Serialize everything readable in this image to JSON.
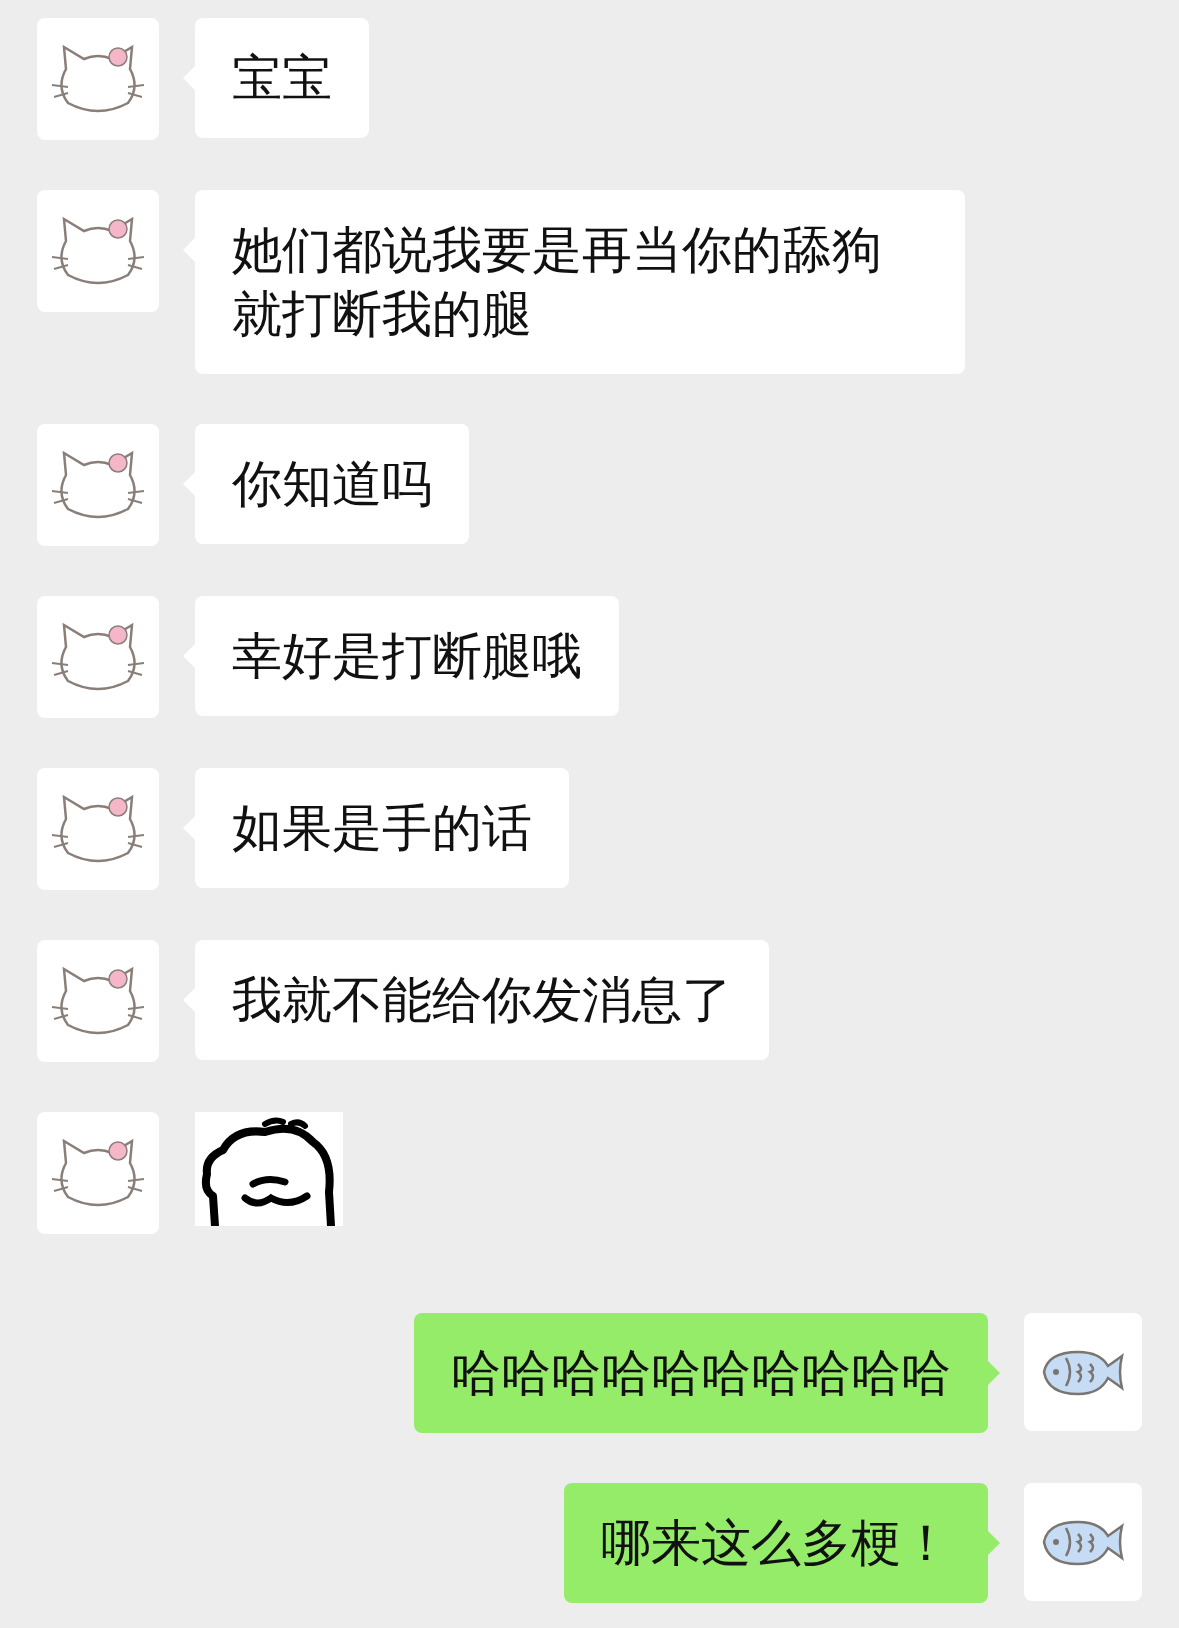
{
  "messages": [
    {
      "outgoing": false,
      "kind": "text",
      "text": "宝宝"
    },
    {
      "outgoing": false,
      "kind": "text",
      "text": "她们都说我要是再当你的舔狗就打断我的腿"
    },
    {
      "outgoing": false,
      "kind": "text",
      "text": "你知道吗"
    },
    {
      "outgoing": false,
      "kind": "text",
      "text": "幸好是打断腿哦"
    },
    {
      "outgoing": false,
      "kind": "text",
      "text": "如果是手的话"
    },
    {
      "outgoing": false,
      "kind": "text",
      "text": "我就不能给你发消息了"
    },
    {
      "outgoing": false,
      "kind": "sticker"
    },
    {
      "outgoing": true,
      "kind": "text",
      "text": "哈哈哈哈哈哈哈哈哈哈"
    },
    {
      "outgoing": true,
      "kind": "text",
      "text": "哪来这么多梗！"
    }
  ]
}
